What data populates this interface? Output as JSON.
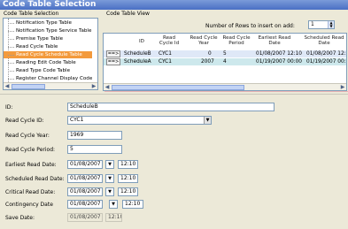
{
  "window": {
    "title": "Code Table Selection"
  },
  "left_pane": {
    "label": "Code Table Selection",
    "items": [
      "Notification Type Table",
      "Notification Type Service Table",
      "Premise Type Table",
      "Read Cycle Table",
      "Read Cycle Schedule Table",
      "Reading Edit Code Table",
      "Read Type Code Table",
      "Register Channel Display Code"
    ],
    "selected_index": 4
  },
  "right_pane": {
    "label": "Code Table View",
    "rows_label": "Number of Rows to insert on add:",
    "rows_value": "1"
  },
  "grid": {
    "headers": [
      "ID",
      "Read Cycle Id",
      "Read Cycle Year",
      "Read Cycle Period",
      "Earliest Read Date",
      "Scheduled Read Date"
    ],
    "rows": [
      {
        "button": "==>",
        "id": "ScheduleB",
        "cycle_id": "CYC1",
        "year": "0",
        "period": "5",
        "earliest": "01/08/2007 12:10",
        "scheduled": "01/08/2007 12:1"
      },
      {
        "button": "==>",
        "id": "ScheduleA",
        "cycle_id": "CYC1",
        "year": "2007",
        "period": "4",
        "earliest": "01/19/2007 00:00",
        "scheduled": "01/19/2007 00:0"
      }
    ]
  },
  "form": {
    "id_label": "ID:",
    "id_value": "ScheduleB",
    "read_cycle_id_label": "Read Cycle ID:",
    "read_cycle_id_value": "CYC1",
    "year_label": "Read Cycle Year:",
    "year_value": "1969",
    "period_label": "Read Cycle Period:",
    "period_value": "5",
    "earliest_label": "Earliest Read Date:",
    "earliest_date": "01/08/2007",
    "earliest_time": "12:10",
    "scheduled_label": "Scheduled Read Date:",
    "scheduled_date": "01/08/2007",
    "scheduled_time": "12:10",
    "critical_label": "Critical Read Date:",
    "critical_date": "01/08/2007",
    "critical_time": "12:10",
    "contingency_label": "Contingency Date",
    "contingency_date": "01/08/2007",
    "contingency_time": "12:10",
    "save_label": "Save Date:",
    "save_date": "01/08/2007",
    "save_time": "12:10"
  },
  "icons": {
    "dropdown": "chevron-down-icon",
    "spin": "spin-icon",
    "scroll_left": "arrow-left-icon",
    "scroll_right": "arrow-right-icon"
  },
  "colors": {
    "title_bar": "#4a6fc4",
    "selected_item": "#f39a3c",
    "row_a": "#dfe8f7",
    "row_b": "#cde8ec"
  }
}
